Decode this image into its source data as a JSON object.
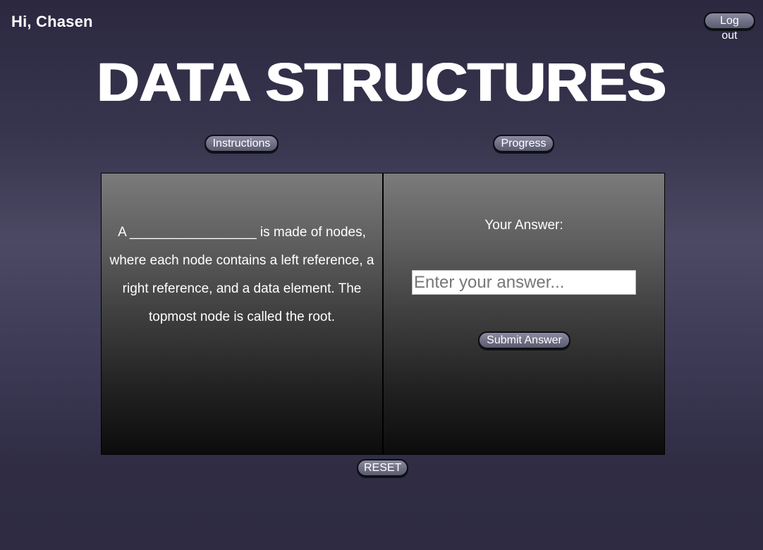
{
  "header": {
    "greeting": "Hi, Chasen",
    "logout_label": "Log out",
    "title": "DATA STRUCTURES"
  },
  "nav": {
    "instructions_label": "Instructions",
    "progress_label": "Progress"
  },
  "question": {
    "text": "A _________________ is made of nodes, where each node contains a left reference, a right reference, and a data element. The topmost node is called the root."
  },
  "answer": {
    "label": "Your Answer:",
    "value": "",
    "placeholder": "Enter your answer...",
    "submit_label": "Submit Answer"
  },
  "footer": {
    "reset_label": "RESET"
  }
}
